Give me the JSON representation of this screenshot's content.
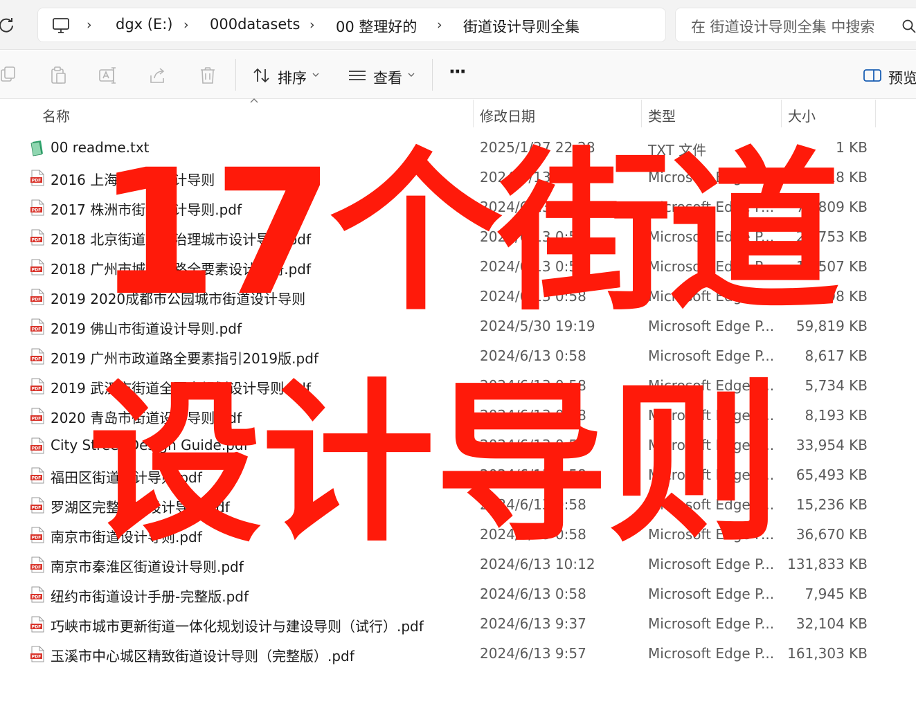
{
  "address_bar": {
    "breadcrumbs": [
      "dgx (E:)",
      "000datasets",
      "00 整理好的",
      "街道设计导则全集"
    ],
    "search_placeholder": "在 街道设计导则全集 中搜索"
  },
  "toolbar": {
    "sort_label": "排序",
    "view_label": "查看",
    "more_label": "···",
    "preview_label": "预览"
  },
  "columns": {
    "name": "名称",
    "date": "修改日期",
    "type": "类型",
    "size": "大小"
  },
  "files": [
    {
      "icon": "txt-file-icon",
      "name": "00 readme.txt",
      "date": "2025/1/27 22:28",
      "type": "TXT 文件",
      "size": "1 KB"
    },
    {
      "icon": "pdf-file-icon",
      "name": "2016 上海市街道设计导则",
      "date": "2024/6/13 0:58",
      "type": "Microsoft Edge P...",
      "size": "52,918 KB"
    },
    {
      "icon": "pdf-file-icon",
      "name": "2017 株洲市街道设计导则.pdf",
      "date": "2024/6/13 0:58",
      "type": "Microsoft Edge P...",
      "size": "70,809 KB"
    },
    {
      "icon": "pdf-file-icon",
      "name": "2018 北京街道更新治理城市设计导则.pdf",
      "date": "2024/6/13 0:58",
      "type": "Microsoft Edge P...",
      "size": "25,753 KB"
    },
    {
      "icon": "pdf-file-icon",
      "name": "2018 广州市城市道路全要素设计手册.pdf",
      "date": "2024/6/13 0:58",
      "type": "Microsoft Edge P...",
      "size": "12,507 KB"
    },
    {
      "icon": "pdf-file-icon",
      "name": "2019 2020成都市公园城市街道设计导则",
      "date": "2024/6/13 0:58",
      "type": "Microsoft Edge P...",
      "size": "98 KB"
    },
    {
      "icon": "pdf-file-icon",
      "name": "2019 佛山市街道设计导则.pdf",
      "date": "2024/5/30 19:19",
      "type": "Microsoft Edge P...",
      "size": "59,819 KB"
    },
    {
      "icon": "pdf-file-icon",
      "name": "2019 广州市政道路全要素指引2019版.pdf",
      "date": "2024/6/13 0:58",
      "type": "Microsoft Edge P...",
      "size": "8,617 KB"
    },
    {
      "icon": "pdf-file-icon",
      "name": "2019 武汉市街道全要素规划设计导则.pdf",
      "date": "2024/6/13 0:58",
      "type": "Microsoft Edge P...",
      "size": "5,734 KB"
    },
    {
      "icon": "pdf-file-icon",
      "name": "2020 青岛市街道设计导则.pdf",
      "date": "2024/6/13 0:58",
      "type": "Microsoft Edge P...",
      "size": "8,193 KB"
    },
    {
      "icon": "pdf-file-icon",
      "name": "City Street Design Guide.pdf",
      "date": "2024/6/13 0:58",
      "type": "Microsoft Edge P...",
      "size": "33,954 KB"
    },
    {
      "icon": "pdf-file-icon",
      "name": "福田区街道设计导则.pdf",
      "date": "2024/6/13 0:58",
      "type": "Microsoft Edge P...",
      "size": "65,493 KB"
    },
    {
      "icon": "pdf-file-icon",
      "name": "罗湖区完整街道设计导则.pdf",
      "date": "2024/6/13 0:58",
      "type": "Microsoft Edge P...",
      "size": "15,236 KB"
    },
    {
      "icon": "pdf-file-icon",
      "name": "南京市街道设计导则.pdf",
      "date": "2024/6/13 0:58",
      "type": "Microsoft Edge P...",
      "size": "36,670 KB"
    },
    {
      "icon": "pdf-file-icon",
      "name": "南京市秦淮区街道设计导则.pdf",
      "date": "2024/6/13 10:12",
      "type": "Microsoft Edge P...",
      "size": "131,833 KB"
    },
    {
      "icon": "pdf-file-icon",
      "name": "纽约市街道设计手册-完整版.pdf",
      "date": "2024/6/13 0:58",
      "type": "Microsoft Edge P...",
      "size": "7,945 KB"
    },
    {
      "icon": "pdf-file-icon",
      "name": "巧峡市城市更新街道一体化规划设计与建设导则（试行）.pdf",
      "date": "2024/6/13 9:37",
      "type": "Microsoft Edge P...",
      "size": "32,104 KB"
    },
    {
      "icon": "pdf-file-icon",
      "name": "玉溪市中心城区精致街道设计导则（完整版）.pdf",
      "date": "2024/6/13 9:57",
      "type": "Microsoft Edge P...",
      "size": "161,303 KB"
    }
  ],
  "overlay": {
    "line1": "17个街道",
    "line2": "设计导则"
  },
  "colors": {
    "overlay_red": "#ff1a0a",
    "pdf_red": "#d9342b",
    "txt_green": "#2fa66e"
  }
}
